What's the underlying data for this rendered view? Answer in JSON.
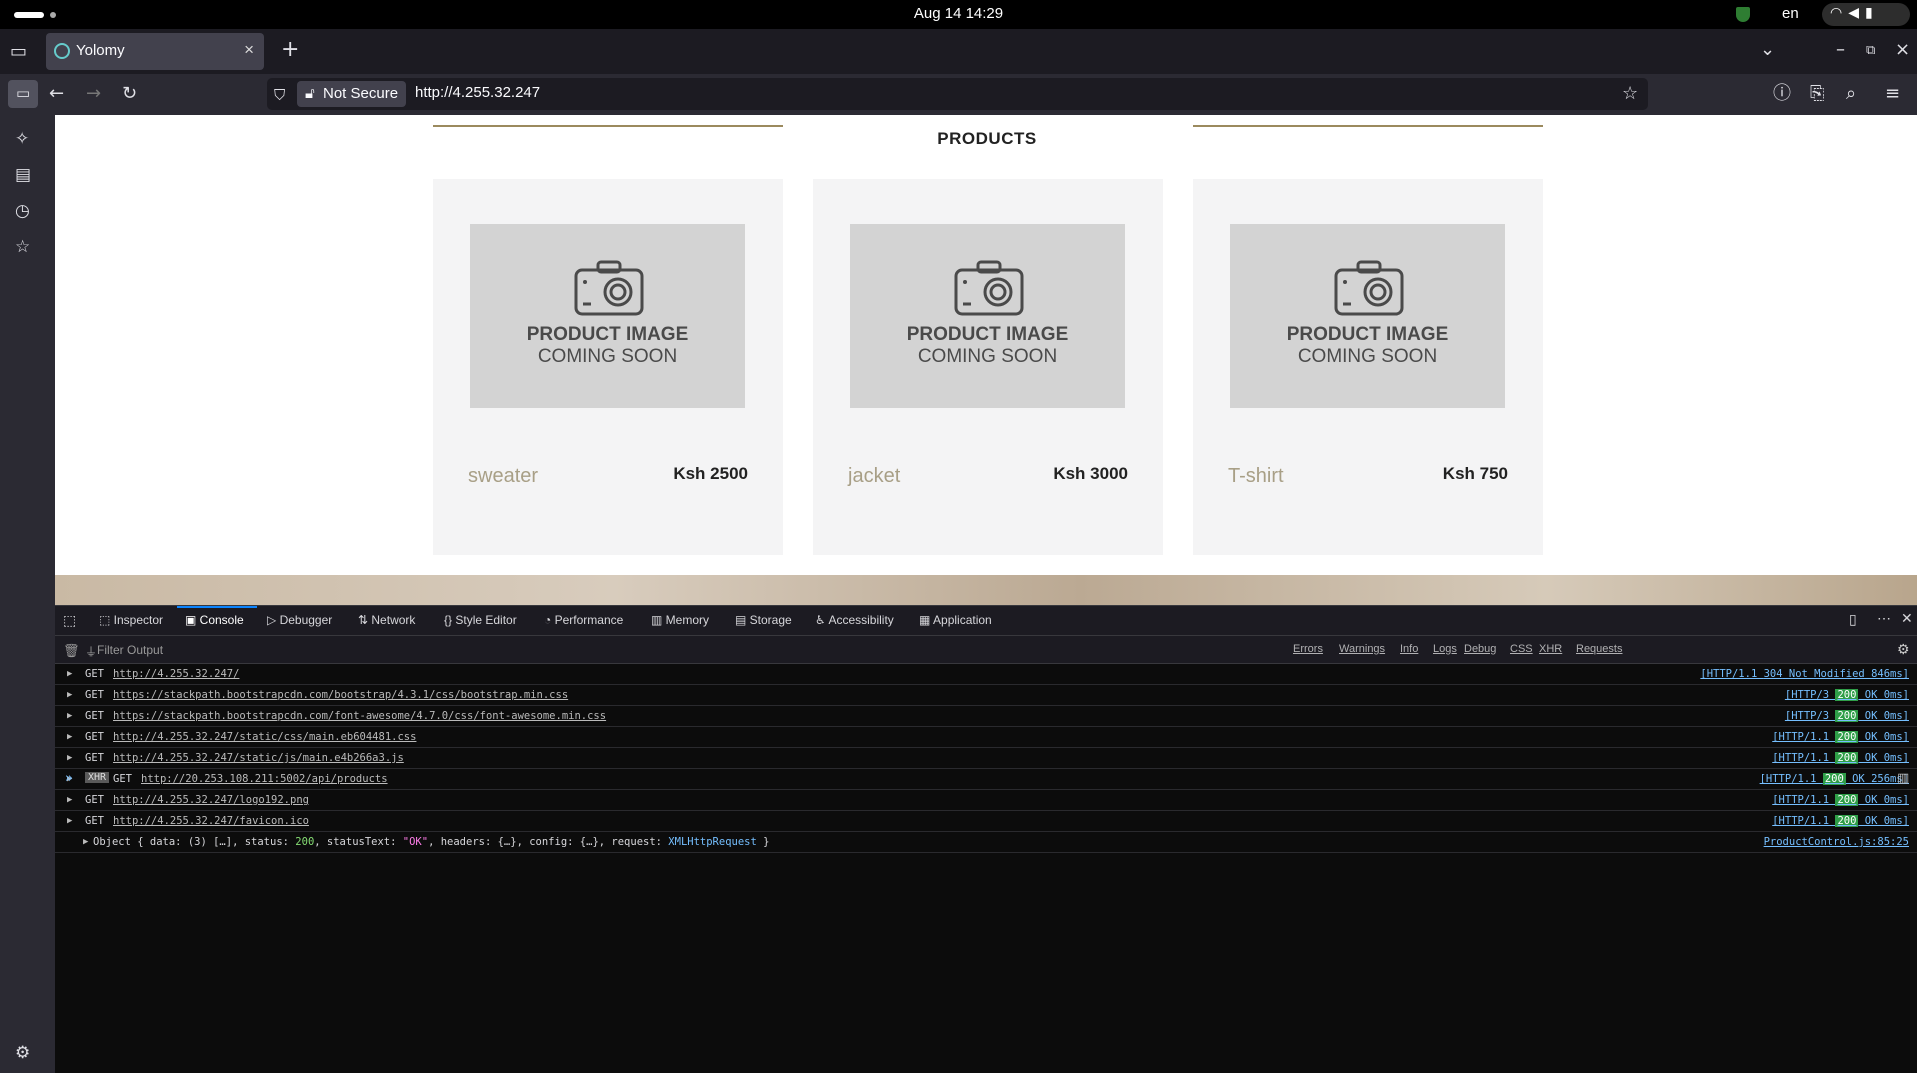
{
  "os": {
    "clock": "Aug 14  14:29",
    "lang": "en"
  },
  "browser": {
    "tab_title": "Yolomy",
    "security_label": "Not Secure",
    "url": "http://4.255.32.247"
  },
  "page": {
    "section_title": "PRODUCTS",
    "placeholder_line1": "PRODUCT IMAGE",
    "placeholder_line2": "COMING SOON",
    "products": [
      {
        "name": "sweater",
        "price": "Ksh 2500"
      },
      {
        "name": "jacket",
        "price": "Ksh 3000"
      },
      {
        "name": "T-shirt",
        "price": "Ksh 750"
      }
    ]
  },
  "devtools": {
    "tabs": [
      "Inspector",
      "Console",
      "Debugger",
      "Network",
      "Style Editor",
      "Performance",
      "Memory",
      "Storage",
      "Accessibility",
      "Application"
    ],
    "filter_placeholder": "Filter Output",
    "filter_buttons": [
      "Errors",
      "Warnings",
      "Info",
      "Logs",
      "Debug",
      "CSS",
      "XHR",
      "Requests"
    ],
    "rows": [
      {
        "method": "GET",
        "xhr": "",
        "url": "http://4.255.32.247/",
        "proto": "[HTTP/1.1 ",
        "status": "304",
        "rest": " Not Modified 846ms]"
      },
      {
        "method": "GET",
        "xhr": "",
        "url": "https://stackpath.bootstrapcdn.com/bootstrap/4.3.1/css/bootstrap.min.css",
        "proto": "[HTTP/3 ",
        "status": "200",
        "rest": " OK 0ms]"
      },
      {
        "method": "GET",
        "xhr": "",
        "url": "https://stackpath.bootstrapcdn.com/font-awesome/4.7.0/css/font-awesome.min.css",
        "proto": "[HTTP/3 ",
        "status": "200",
        "rest": " OK 0ms]"
      },
      {
        "method": "GET",
        "xhr": "",
        "url": "http://4.255.32.247/static/css/main.eb604481.css",
        "proto": "[HTTP/1.1 ",
        "status": "200",
        "rest": " OK 0ms]"
      },
      {
        "method": "GET",
        "xhr": "",
        "url": "http://4.255.32.247/static/js/main.e4b266a3.js",
        "proto": "[HTTP/1.1 ",
        "status": "200",
        "rest": " OK 0ms]"
      },
      {
        "method": "GET",
        "xhr": "XHR",
        "url": "http://20.253.108.211:5002/api/products",
        "proto": "[HTTP/1.1 ",
        "status": "200",
        "rest": " OK 256ms]"
      },
      {
        "method": "GET",
        "xhr": "",
        "url": "http://4.255.32.247/logo192.png",
        "proto": "[HTTP/1.1 ",
        "status": "200",
        "rest": " OK 0ms]"
      },
      {
        "method": "GET",
        "xhr": "",
        "url": "http://4.255.32.247/favicon.ico",
        "proto": "[HTTP/1.1 ",
        "status": "200",
        "rest": " OK 0ms]"
      }
    ],
    "object_log": {
      "prefix": "Object { data: (3) […], status: ",
      "status": "200",
      "mid": ", statusText: ",
      "status_text": "\"OK\"",
      "rest": ", headers: {…}, config: {…}, request: ",
      "request": "XMLHttpRequest",
      "end": " }",
      "source": "ProductControl.js:85:25"
    },
    "prompt": "»"
  }
}
